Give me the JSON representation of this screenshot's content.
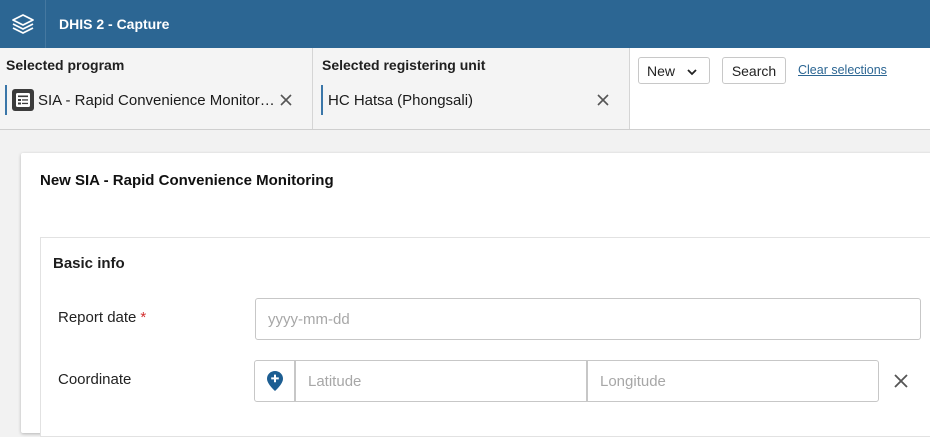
{
  "header": {
    "app_title": "DHIS 2 - Capture",
    "logo_icon": "dhis2-stack-logo-icon"
  },
  "selection": {
    "program": {
      "label": "Selected program",
      "value": "SIA - Rapid Convenience Monitoring",
      "icon": "program-form-icon"
    },
    "org_unit": {
      "label": "Selected registering unit",
      "value": "HC Hatsa (Phongsali)"
    },
    "new_button": "New",
    "search_button": "Search",
    "clear_link": "Clear selections"
  },
  "form": {
    "title": "New SIA - Rapid Convenience Monitoring",
    "section_title": "Basic info",
    "report_date": {
      "label": "Report date",
      "required_marker": "*",
      "placeholder": "yyyy-mm-dd"
    },
    "coordinate": {
      "label": "Coordinate",
      "lat_placeholder": "Latitude",
      "lng_placeholder": "Longitude"
    }
  },
  "colors": {
    "header_bg": "#2c6693",
    "accent": "#3a76a8",
    "required": "#d32f2f"
  }
}
